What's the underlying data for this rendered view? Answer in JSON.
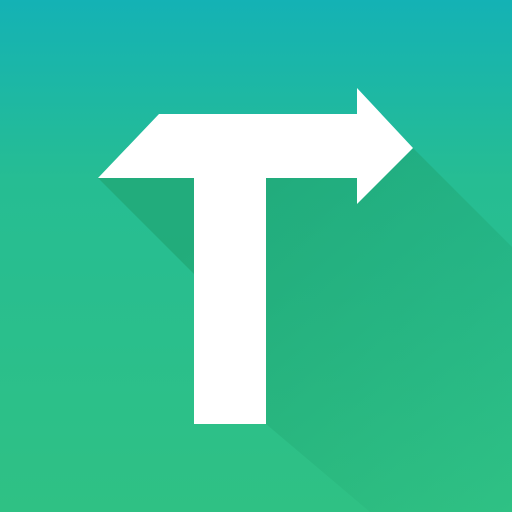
{
  "icon": {
    "name": "t-arrow-logo",
    "colors": {
      "gradient_top": "#14b2b5",
      "gradient_mid": "#26bd93",
      "gradient_bottom": "#2fc184",
      "long_shadow": "#1e9e6a",
      "glyph": "#ffffff"
    }
  }
}
